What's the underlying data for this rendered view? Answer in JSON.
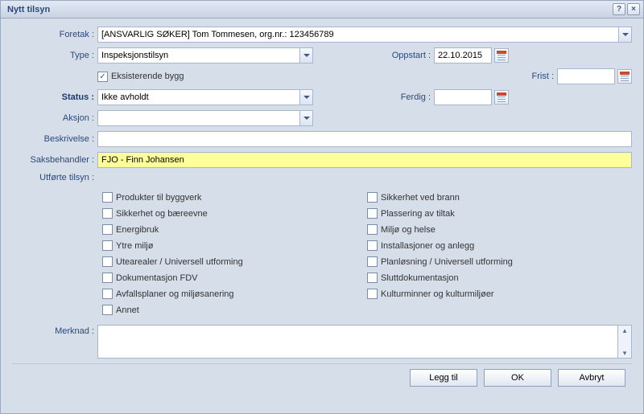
{
  "window": {
    "title": "Nytt tilsyn"
  },
  "labels": {
    "foretak": "Foretak :",
    "type": "Type :",
    "status": "Status :",
    "aksjon": "Aksjon :",
    "beskrivelse": "Beskrivelse :",
    "saksbehandler": "Saksbehandler :",
    "utforteTilsyn": "Utførte tilsyn :",
    "merknad": "Merknad :",
    "oppstart": "Oppstart :",
    "frist": "Frist :",
    "ferdig": "Ferdig :",
    "eksisterende": "Eksisterende bygg"
  },
  "fields": {
    "foretak": "[ANSVARLIG SØKER] Tom Tommesen, org.nr.: 123456789",
    "type": "Inspeksjonstilsyn",
    "status": "Ikke avholdt",
    "aksjon": "",
    "beskrivelse": "",
    "saksbehandler": "FJO - Finn Johansen",
    "oppstart": "22.10.2015",
    "frist": "",
    "ferdig": "",
    "merknad": "",
    "eksisterende_checked": "✓"
  },
  "checkgroups": {
    "left": [
      "Produkter til byggverk",
      "Sikkerhet og bæreevne",
      "Energibruk",
      "Ytre miljø",
      "Utearealer / Universell utforming",
      "Dokumentasjon FDV",
      "Avfallsplaner og miljøsanering",
      "Annet"
    ],
    "right": [
      "Sikkerhet ved brann",
      "Plassering av tiltak",
      "Miljø og helse",
      "Installasjoner og anlegg",
      "Planløsning / Universell utforming",
      "Sluttdokumentasjon",
      "Kulturminner og kulturmiljøer"
    ]
  },
  "buttons": {
    "leggTil": "Legg til",
    "ok": "OK",
    "avbryt": "Avbryt"
  }
}
